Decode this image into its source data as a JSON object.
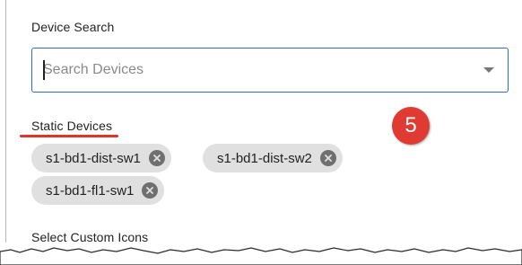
{
  "device_search": {
    "label": "Device Search",
    "placeholder": "Search Devices",
    "value": ""
  },
  "static_devices": {
    "label": "Static Devices",
    "chips": [
      {
        "label": "s1-bd1-dist-sw1",
        "remove_icon": "close-circle-icon"
      },
      {
        "label": "s1-bd1-dist-sw2",
        "remove_icon": "close-circle-icon"
      },
      {
        "label": "s1-bd1-fl1-sw1",
        "remove_icon": "close-circle-icon"
      }
    ]
  },
  "custom_icons": {
    "label": "Select Custom Icons"
  },
  "annotation": {
    "step_number": "5",
    "badge_color": "#df3b33",
    "underline_color": "#e0332c"
  },
  "colors": {
    "input_border": "#2d6cc9",
    "chip_background": "#e0e0e0",
    "chip_remove": "#6f6f6f"
  }
}
